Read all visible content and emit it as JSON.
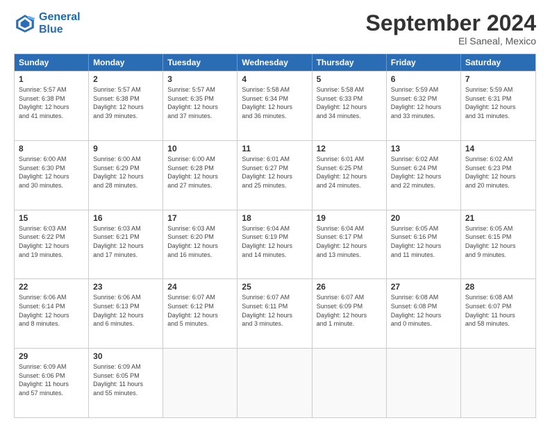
{
  "header": {
    "logo": {
      "line1": "General",
      "line2": "Blue"
    },
    "title": "September 2024",
    "subtitle": "El Saneal, Mexico"
  },
  "calendar": {
    "days_of_week": [
      "Sunday",
      "Monday",
      "Tuesday",
      "Wednesday",
      "Thursday",
      "Friday",
      "Saturday"
    ],
    "rows": [
      [
        {
          "day": "",
          "info": ""
        },
        {
          "day": "2",
          "info": "Sunrise: 5:57 AM\nSunset: 6:38 PM\nDaylight: 12 hours\nand 39 minutes."
        },
        {
          "day": "3",
          "info": "Sunrise: 5:57 AM\nSunset: 6:35 PM\nDaylight: 12 hours\nand 37 minutes."
        },
        {
          "day": "4",
          "info": "Sunrise: 5:58 AM\nSunset: 6:34 PM\nDaylight: 12 hours\nand 36 minutes."
        },
        {
          "day": "5",
          "info": "Sunrise: 5:58 AM\nSunset: 6:33 PM\nDaylight: 12 hours\nand 34 minutes."
        },
        {
          "day": "6",
          "info": "Sunrise: 5:59 AM\nSunset: 6:32 PM\nDaylight: 12 hours\nand 33 minutes."
        },
        {
          "day": "7",
          "info": "Sunrise: 5:59 AM\nSunset: 6:31 PM\nDaylight: 12 hours\nand 31 minutes."
        }
      ],
      [
        {
          "day": "8",
          "info": "Sunrise: 6:00 AM\nSunset: 6:30 PM\nDaylight: 12 hours\nand 30 minutes."
        },
        {
          "day": "9",
          "info": "Sunrise: 6:00 AM\nSunset: 6:29 PM\nDaylight: 12 hours\nand 28 minutes."
        },
        {
          "day": "10",
          "info": "Sunrise: 6:00 AM\nSunset: 6:28 PM\nDaylight: 12 hours\nand 27 minutes."
        },
        {
          "day": "11",
          "info": "Sunrise: 6:01 AM\nSunset: 6:27 PM\nDaylight: 12 hours\nand 25 minutes."
        },
        {
          "day": "12",
          "info": "Sunrise: 6:01 AM\nSunset: 6:25 PM\nDaylight: 12 hours\nand 24 minutes."
        },
        {
          "day": "13",
          "info": "Sunrise: 6:02 AM\nSunset: 6:24 PM\nDaylight: 12 hours\nand 22 minutes."
        },
        {
          "day": "14",
          "info": "Sunrise: 6:02 AM\nSunset: 6:23 PM\nDaylight: 12 hours\nand 20 minutes."
        }
      ],
      [
        {
          "day": "15",
          "info": "Sunrise: 6:03 AM\nSunset: 6:22 PM\nDaylight: 12 hours\nand 19 minutes."
        },
        {
          "day": "16",
          "info": "Sunrise: 6:03 AM\nSunset: 6:21 PM\nDaylight: 12 hours\nand 17 minutes."
        },
        {
          "day": "17",
          "info": "Sunrise: 6:03 AM\nSunset: 6:20 PM\nDaylight: 12 hours\nand 16 minutes."
        },
        {
          "day": "18",
          "info": "Sunrise: 6:04 AM\nSunset: 6:19 PM\nDaylight: 12 hours\nand 14 minutes."
        },
        {
          "day": "19",
          "info": "Sunrise: 6:04 AM\nSunset: 6:17 PM\nDaylight: 12 hours\nand 13 minutes."
        },
        {
          "day": "20",
          "info": "Sunrise: 6:05 AM\nSunset: 6:16 PM\nDaylight: 12 hours\nand 11 minutes."
        },
        {
          "day": "21",
          "info": "Sunrise: 6:05 AM\nSunset: 6:15 PM\nDaylight: 12 hours\nand 9 minutes."
        }
      ],
      [
        {
          "day": "22",
          "info": "Sunrise: 6:06 AM\nSunset: 6:14 PM\nDaylight: 12 hours\nand 8 minutes."
        },
        {
          "day": "23",
          "info": "Sunrise: 6:06 AM\nSunset: 6:13 PM\nDaylight: 12 hours\nand 6 minutes."
        },
        {
          "day": "24",
          "info": "Sunrise: 6:07 AM\nSunset: 6:12 PM\nDaylight: 12 hours\nand 5 minutes."
        },
        {
          "day": "25",
          "info": "Sunrise: 6:07 AM\nSunset: 6:11 PM\nDaylight: 12 hours\nand 3 minutes."
        },
        {
          "day": "26",
          "info": "Sunrise: 6:07 AM\nSunset: 6:09 PM\nDaylight: 12 hours\nand 1 minute."
        },
        {
          "day": "27",
          "info": "Sunrise: 6:08 AM\nSunset: 6:08 PM\nDaylight: 12 hours\nand 0 minutes."
        },
        {
          "day": "28",
          "info": "Sunrise: 6:08 AM\nSunset: 6:07 PM\nDaylight: 11 hours\nand 58 minutes."
        }
      ],
      [
        {
          "day": "29",
          "info": "Sunrise: 6:09 AM\nSunset: 6:06 PM\nDaylight: 11 hours\nand 57 minutes."
        },
        {
          "day": "30",
          "info": "Sunrise: 6:09 AM\nSunset: 6:05 PM\nDaylight: 11 hours\nand 55 minutes."
        },
        {
          "day": "",
          "info": ""
        },
        {
          "day": "",
          "info": ""
        },
        {
          "day": "",
          "info": ""
        },
        {
          "day": "",
          "info": ""
        },
        {
          "day": "",
          "info": ""
        }
      ]
    ],
    "first_row": [
      {
        "day": "1",
        "info": "Sunrise: 5:57 AM\nSunset: 6:38 PM\nDaylight: 12 hours\nand 41 minutes."
      }
    ]
  }
}
